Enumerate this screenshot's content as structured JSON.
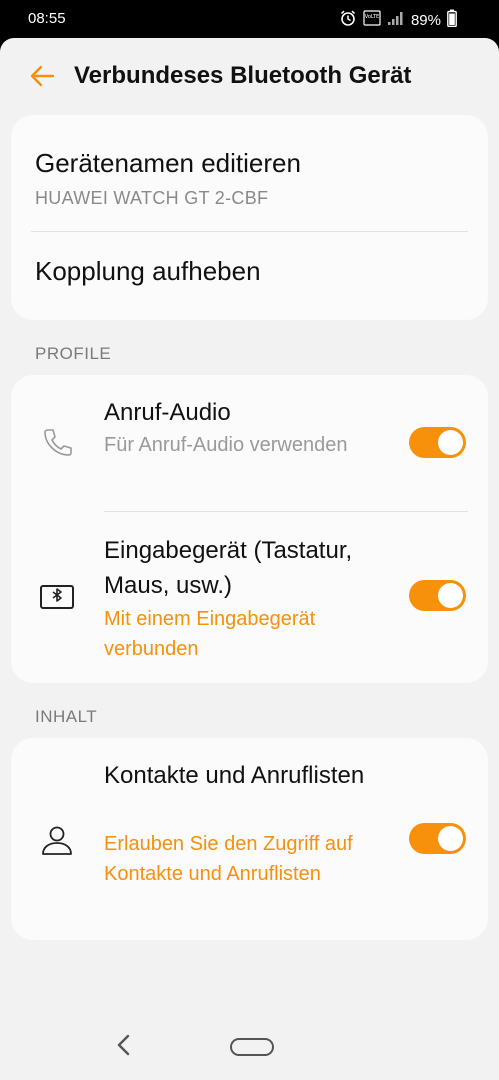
{
  "status_bar": {
    "time": "08:55",
    "battery": "89%",
    "icons": [
      "alarm-icon",
      "volte-icon",
      "signal-icon",
      "battery-icon"
    ]
  },
  "header": {
    "title": "Verbundeses Bluetooth Gerät"
  },
  "device_card": {
    "rename_title": "Gerätenamen editieren",
    "device_name": "HUAWEI WATCH GT 2-CBF",
    "unpair_title": "Kopplung aufheben"
  },
  "profiles": {
    "section_label": "PROFILE",
    "items": [
      {
        "icon": "phone-icon",
        "title": "Anruf-Audio",
        "subtitle": "Für Anruf-Audio verwenden",
        "enabled": true
      },
      {
        "icon": "bluetooth-keyboard-icon",
        "title": "Eingabegerät (Tastatur, Maus, usw.)",
        "subtitle": "Mit einem Eingabegerät verbunden",
        "enabled": true
      }
    ]
  },
  "content": {
    "section_label": "INHALT",
    "items": [
      {
        "icon": "contact-icon",
        "title": "Kontakte und Anruflisten",
        "subtitle": "Erlauben Sie den Zugriff auf Kontakte und Anruflisten",
        "enabled": true
      }
    ]
  },
  "colors": {
    "accent": "#f7900a",
    "background": "#f2f2f2",
    "card": "#fbfbfb"
  }
}
